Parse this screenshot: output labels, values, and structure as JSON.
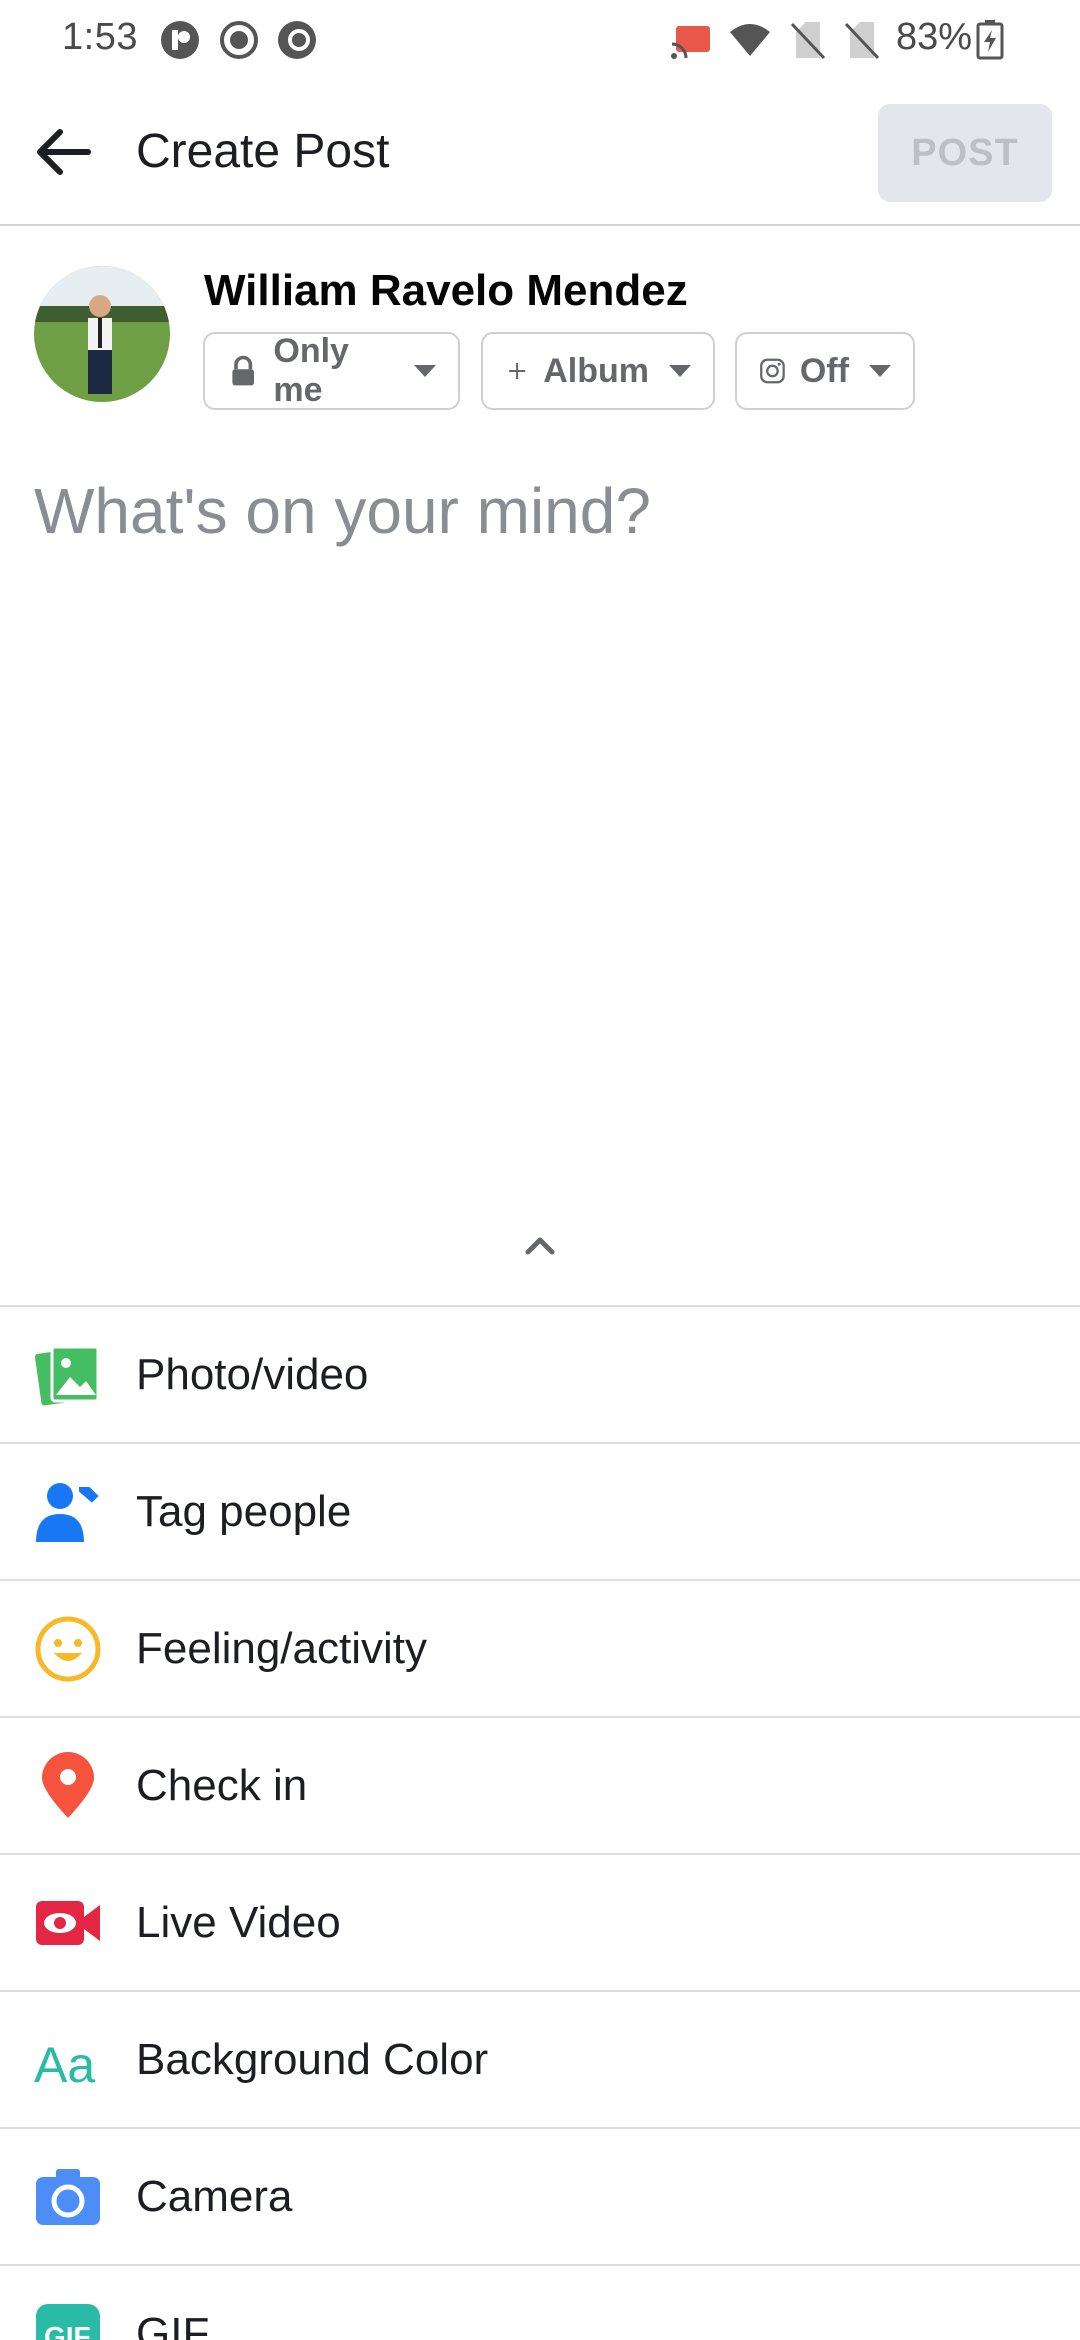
{
  "status_bar": {
    "time": "1:53",
    "battery": "83%",
    "icons": [
      "app-icon-p",
      "record-icon",
      "app-icon-circle",
      "cast-icon",
      "wifi-icon",
      "no-sim-icon",
      "no-sim-icon",
      "battery-charging-icon"
    ]
  },
  "header": {
    "title": "Create Post",
    "post_label": "POST"
  },
  "user": {
    "name": "William Ravelo Mendez"
  },
  "chips": {
    "audience": "Only me",
    "album": "Album",
    "instagram": "Off"
  },
  "composer": {
    "placeholder": "What's on your mind?"
  },
  "options": [
    {
      "label": "Photo/video",
      "icon": "photo-icon"
    },
    {
      "label": "Tag people",
      "icon": "tag-people-icon"
    },
    {
      "label": "Feeling/activity",
      "icon": "smile-icon"
    },
    {
      "label": "Check in",
      "icon": "location-pin-icon"
    },
    {
      "label": "Live Video",
      "icon": "live-video-icon"
    },
    {
      "label": "Background Color",
      "icon": "text-style-icon"
    },
    {
      "label": "Camera",
      "icon": "camera-icon"
    },
    {
      "label": "GIF",
      "icon": "gif-icon"
    }
  ],
  "colors": {
    "photo": "#45bd62",
    "tag": "#1877f2",
    "feeling": "#f7b928",
    "checkin": "#f5533d",
    "live": "#e42645",
    "background": "#2abba7",
    "camera": "#4c8df6",
    "gif": "#2abba7"
  }
}
